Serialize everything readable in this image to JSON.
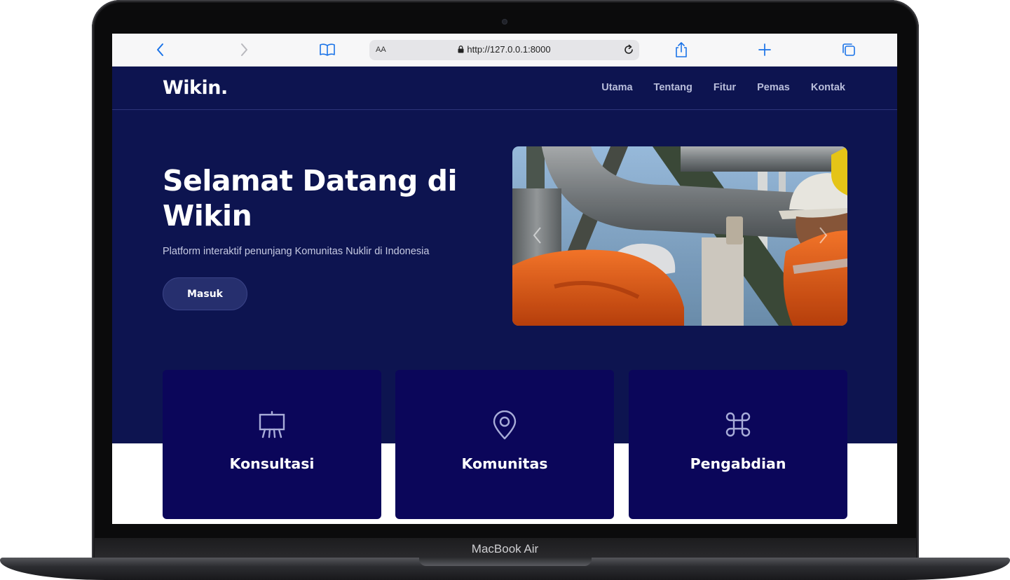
{
  "device": {
    "label": "MacBook Air"
  },
  "browser": {
    "text_size_label": "AA",
    "url": "http://127.0.0.1:8000",
    "accent_color": "#1a73e8",
    "icons": [
      "chevron-left-icon",
      "chevron-right-icon",
      "book-icon",
      "lock-icon",
      "reload-icon",
      "share-icon",
      "plus-icon",
      "tabs-icon"
    ]
  },
  "site": {
    "brand": "Wikin.",
    "nav": [
      "Utama",
      "Tentang",
      "Fitur",
      "Pemas",
      "Kontak"
    ],
    "hero": {
      "title": "Selamat Datang di Wikin",
      "subtitle": "Platform interaktif penunjang Komunitas Nuklir di Indonesia",
      "cta_label": "Masuk"
    },
    "features": [
      {
        "icon": "easel-icon",
        "label": "Konsultasi"
      },
      {
        "icon": "map-pin-icon",
        "label": "Komunitas"
      },
      {
        "icon": "command-icon",
        "label": "Pengabdian"
      }
    ],
    "colors": {
      "hero_bg": "#0d1450",
      "card_bg": "#0b065a",
      "nav_text": "#b9bedb"
    }
  }
}
